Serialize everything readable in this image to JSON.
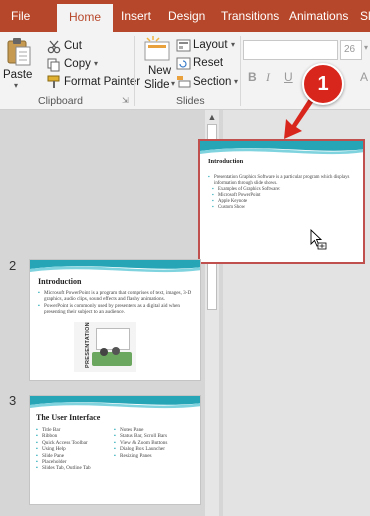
{
  "tabs": [
    "File",
    "Home",
    "Insert",
    "Design",
    "Transitions",
    "Animations",
    "Sl"
  ],
  "ribbon": {
    "clipboard": {
      "paste": "Paste",
      "cut": "Cut",
      "copy": "Copy",
      "format_painter": "Format Painter",
      "group_label": "Clipboard"
    },
    "slides": {
      "new_slide_line1": "New",
      "new_slide_line2": "Slide",
      "layout": "Layout",
      "reset": "Reset",
      "section": "Section",
      "group_label": "Slides"
    },
    "font": {
      "size": "26",
      "bold": "B",
      "italic": "I",
      "underline": "U",
      "grow": "A"
    }
  },
  "badge": "1",
  "slides": [
    {
      "number": "2",
      "title": "Introduction",
      "bullets": [
        "Microsoft PowerPoint is a program that comprises of text, images, 3-D graphics, audio clips, sound effects and flashy animations.",
        "PowerPoint is commonly used by presenters as a digital aid when presenting their subject to an audience."
      ],
      "image_text": "PRESENTATION"
    },
    {
      "number": "3",
      "title": "The User Interface",
      "col1": [
        "Title Bar",
        "Ribbon",
        "Quick Access Toolbar",
        "Using Help",
        "Slide Pane",
        "Placeholder",
        "Slides Tab, Outline Tab"
      ],
      "col2": [
        "Notes Pane",
        "Status Bar, Scroll Bars",
        "View & Zoom Buttons",
        "Dialog Box Launcher",
        "Resizing Panes"
      ]
    }
  ],
  "editor_slide": {
    "title": "Introduction",
    "bullet": "Presentation Graphics Software is a particular program which displays information through slide shows.",
    "sub_header": "Examples of Graphics Software:",
    "sub_items": [
      "Microsoft PowerPoint",
      "Apple Keynote",
      "Custom Show"
    ]
  },
  "colors": {
    "accent": "#b7472a",
    "highlight_border": "#c0504d",
    "badge": "#d9261c",
    "bullet": "#2aa9b8"
  }
}
